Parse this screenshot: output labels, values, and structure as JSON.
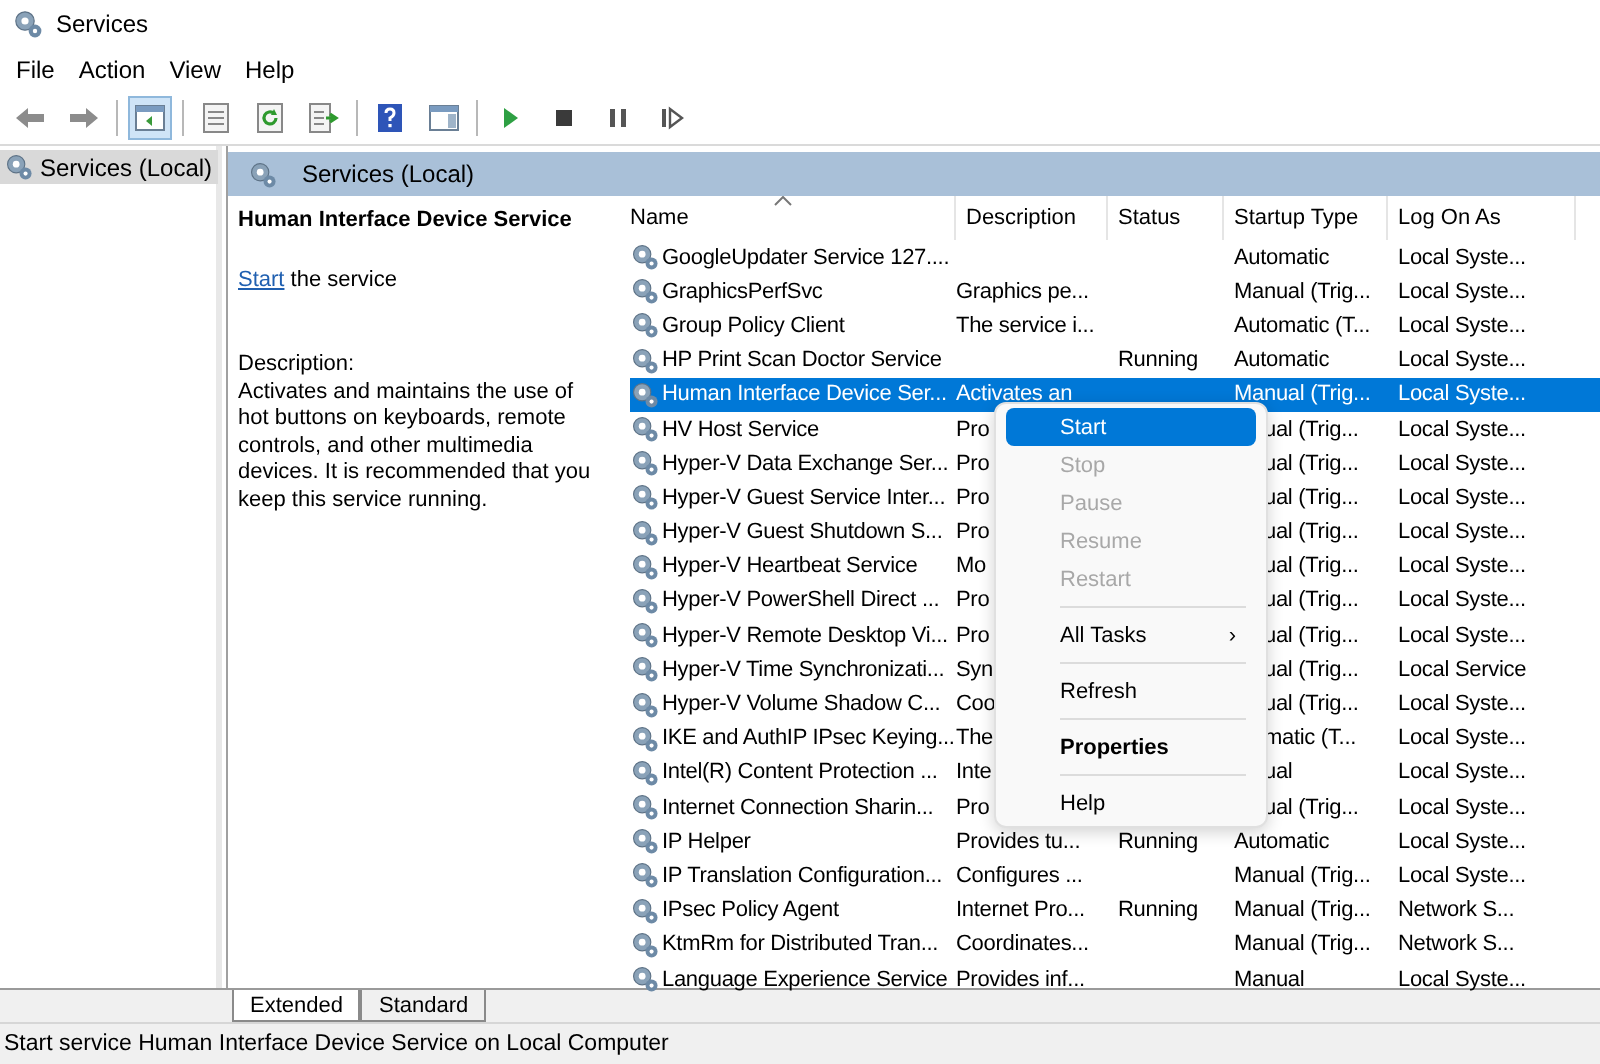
{
  "window": {
    "title": "Services"
  },
  "menu_bar": [
    "File",
    "Action",
    "View",
    "Help"
  ],
  "toolbar": [
    {
      "kind": "back",
      "on": false
    },
    {
      "kind": "forward",
      "on": false
    },
    {
      "kind": "separator"
    },
    {
      "kind": "console-tree",
      "on": true
    },
    {
      "kind": "separator"
    },
    {
      "kind": "list",
      "on": false
    },
    {
      "kind": "refresh",
      "on": false
    },
    {
      "kind": "export",
      "on": false
    },
    {
      "kind": "separator"
    },
    {
      "kind": "help",
      "on": false
    },
    {
      "kind": "panel",
      "on": false
    },
    {
      "kind": "separator"
    },
    {
      "kind": "play",
      "on": false
    },
    {
      "kind": "stop",
      "on": false
    },
    {
      "kind": "pause",
      "on": false
    },
    {
      "kind": "resume",
      "on": false
    }
  ],
  "tree": {
    "items": [
      {
        "label": "Services (Local)",
        "selected": true
      }
    ]
  },
  "pane": {
    "title": "Services (Local)"
  },
  "details": {
    "title": "Human Interface Device Service",
    "action": {
      "link": "Start",
      "text": "the service"
    },
    "description_label": "Description:",
    "description": "Activates and maintains the use of hot buttons on keyboards, remote controls, and other multimedia devices. It is recommended that you keep this service running."
  },
  "table": {
    "columns": [
      "Name",
      "Description",
      "Status",
      "Startup Type",
      "Log On As"
    ],
    "rows": [
      {
        "cells": [
          "GoogleUpdater Service 127....",
          "",
          "",
          "Automatic",
          "Local Syste..."
        ],
        "selected": false,
        "covered": false
      },
      {
        "cells": [
          "GraphicsPerfSvc",
          "Graphics pe...",
          "",
          "Manual (Trig...",
          "Local Syste..."
        ],
        "selected": false,
        "covered": false
      },
      {
        "cells": [
          "Group Policy Client",
          "The service i...",
          "",
          "Automatic (T...",
          "Local Syste..."
        ],
        "selected": false,
        "covered": false
      },
      {
        "cells": [
          "HP Print Scan Doctor Service",
          "",
          "Running",
          "Automatic",
          "Local Syste..."
        ],
        "selected": false,
        "covered": false
      },
      {
        "cells": [
          "Human Interface Device Ser...",
          "Activates an",
          "",
          "Manual (Trig...",
          "Local Syste..."
        ],
        "selected": true,
        "covered": false
      },
      {
        "cells": [
          "HV Host Service",
          "Pro",
          "",
          "ual (Trig...",
          "Local Syste..."
        ],
        "selected": false,
        "covered": true
      },
      {
        "cells": [
          "Hyper-V Data Exchange Ser...",
          "Pro",
          "",
          "ual (Trig...",
          "Local Syste..."
        ],
        "selected": false,
        "covered": true
      },
      {
        "cells": [
          "Hyper-V Guest Service Inter...",
          "Pro",
          "",
          "ual (Trig...",
          "Local Syste..."
        ],
        "selected": false,
        "covered": true
      },
      {
        "cells": [
          "Hyper-V Guest Shutdown S...",
          "Pro",
          "",
          "ual (Trig...",
          "Local Syste..."
        ],
        "selected": false,
        "covered": true
      },
      {
        "cells": [
          "Hyper-V Heartbeat Service",
          "Mo",
          "",
          "ual (Trig...",
          "Local Syste..."
        ],
        "selected": false,
        "covered": true
      },
      {
        "cells": [
          "Hyper-V PowerShell Direct ...",
          "Pro",
          "",
          "ual (Trig...",
          "Local Syste..."
        ],
        "selected": false,
        "covered": true
      },
      {
        "cells": [
          "Hyper-V Remote Desktop Vi...",
          "Pro",
          "",
          "ual (Trig...",
          "Local Syste..."
        ],
        "selected": false,
        "covered": true
      },
      {
        "cells": [
          "Hyper-V Time Synchronizati...",
          "Syn",
          "",
          "ual (Trig...",
          "Local Service"
        ],
        "selected": false,
        "covered": true
      },
      {
        "cells": [
          "Hyper-V Volume Shadow C...",
          "Coo",
          "",
          "ual (Trig...",
          "Local Syste..."
        ],
        "selected": false,
        "covered": true
      },
      {
        "cells": [
          "IKE and AuthIP IPsec Keying...",
          "The",
          "",
          "matic (T...",
          "Local Syste..."
        ],
        "selected": false,
        "covered": true
      },
      {
        "cells": [
          "Intel(R) Content Protection ...",
          "Inte",
          "",
          "ual",
          "Local Syste..."
        ],
        "selected": false,
        "covered": true
      },
      {
        "cells": [
          "Internet Connection Sharin...",
          "Pro",
          "",
          "ual (Trig...",
          "Local Syste..."
        ],
        "selected": false,
        "covered": true
      },
      {
        "cells": [
          "IP Helper",
          "Provides tu...",
          "Running",
          "Automatic",
          "Local Syste..."
        ],
        "selected": false,
        "covered": false
      },
      {
        "cells": [
          "IP Translation Configuration...",
          "Configures ...",
          "",
          "Manual (Trig...",
          "Local Syste..."
        ],
        "selected": false,
        "covered": false
      },
      {
        "cells": [
          "IPsec Policy Agent",
          "Internet Pro...",
          "Running",
          "Manual (Trig...",
          "Network S..."
        ],
        "selected": false,
        "covered": false
      },
      {
        "cells": [
          "KtmRm for Distributed Tran...",
          "Coordinates...",
          "",
          "Manual (Trig...",
          "Network S..."
        ],
        "selected": false,
        "covered": false
      },
      {
        "cells": [
          "Language Experience Service",
          "Provides inf...",
          "",
          "Manual",
          "Local Syste..."
        ],
        "selected": false,
        "covered": false
      }
    ]
  },
  "context_menu": [
    {
      "kind": "item",
      "label": "Start",
      "selected": true,
      "disabled": false
    },
    {
      "kind": "item",
      "label": "Stop",
      "selected": false,
      "disabled": true
    },
    {
      "kind": "item",
      "label": "Pause",
      "selected": false,
      "disabled": true
    },
    {
      "kind": "item",
      "label": "Resume",
      "selected": false,
      "disabled": true
    },
    {
      "kind": "item",
      "label": "Restart",
      "selected": false,
      "disabled": true
    },
    {
      "kind": "separator"
    },
    {
      "kind": "submenu",
      "label": "All Tasks",
      "arrow": "›",
      "selected": false,
      "disabled": false
    },
    {
      "kind": "separator"
    },
    {
      "kind": "item",
      "label": "Refresh",
      "selected": false,
      "disabled": false
    },
    {
      "kind": "separator"
    },
    {
      "kind": "default",
      "label": "Properties",
      "selected": false,
      "disabled": false
    },
    {
      "kind": "separator"
    },
    {
      "kind": "item",
      "label": "Help",
      "selected": false,
      "disabled": false
    }
  ],
  "view_tabs": [
    {
      "label": "Extended",
      "selected": true
    },
    {
      "label": "Standard",
      "selected": false
    }
  ],
  "status_bar": "Start service Human Interface Device Service on Local Computer"
}
